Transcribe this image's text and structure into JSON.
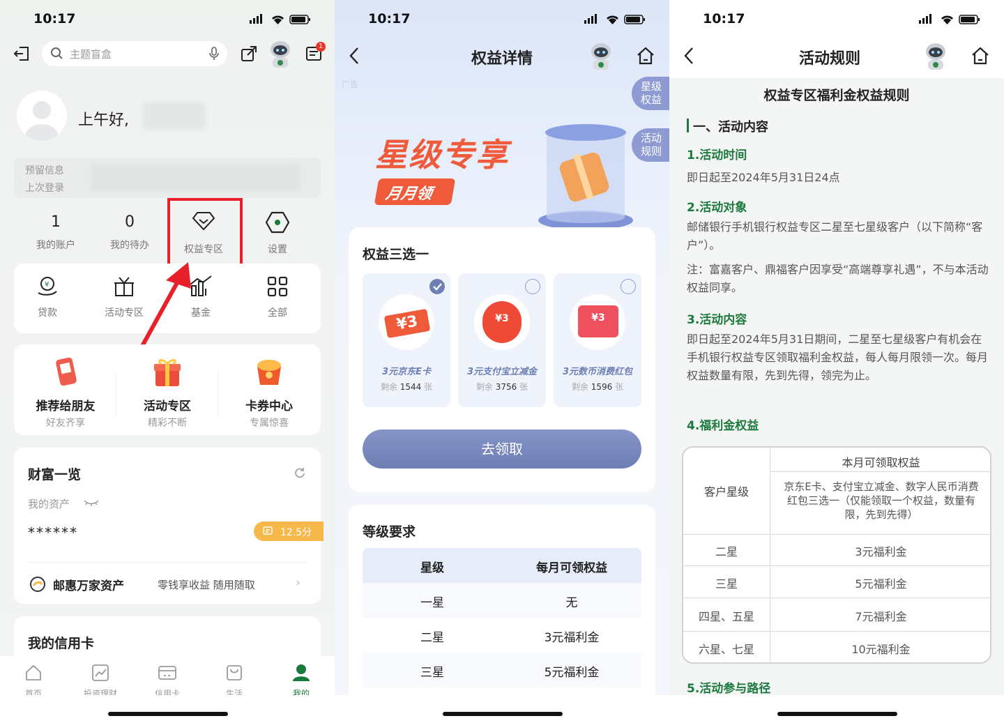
{
  "status_time": "10:17",
  "screen1": {
    "search_placeholder": "主题盲盒",
    "notification_count": "1",
    "greeting": "上午好,",
    "info_line1": "预留信息",
    "info_line2": "上次登录",
    "stats": [
      {
        "value": "1",
        "label": "我的账户"
      },
      {
        "value": "0",
        "label": "我的待办"
      }
    ],
    "quick_links": [
      {
        "label": "权益专区",
        "icon": "diamond-icon"
      },
      {
        "label": "设置",
        "icon": "settings-icon"
      }
    ],
    "services": [
      {
        "label": "贷款",
        "icon": "loan-icon"
      },
      {
        "label": "活动专区",
        "icon": "gift-icon"
      },
      {
        "label": "基金",
        "icon": "fund-chart-icon"
      },
      {
        "label": "全部",
        "icon": "grid-icon"
      }
    ],
    "promos": [
      {
        "title": "推荐给朋友",
        "subtitle": "好友齐享"
      },
      {
        "title": "活动专区",
        "subtitle": "精彩不断"
      },
      {
        "title": "卡券中心",
        "subtitle": "专属惊喜"
      }
    ],
    "wealth": {
      "title": "财富一览",
      "assets_label": "我的资产",
      "masked_value": "******",
      "score_badge": "12.5分",
      "product_name": "邮惠万家资产",
      "product_desc": "零钱享收益 随用随取"
    },
    "credit_title": "我的信用卡",
    "nav": [
      {
        "label": "首页"
      },
      {
        "label": "投资理财"
      },
      {
        "label": "信用卡"
      },
      {
        "label": "生活"
      },
      {
        "label": "我的"
      }
    ],
    "active_color": "#1a7a3a",
    "highlight_color": "#e8202a"
  },
  "screen2": {
    "title": "权益详情",
    "ad_label": "广告",
    "side_tab1": "星级权益",
    "side_tab2": "活动规则",
    "banner_title": "星级专享",
    "banner_sub": "月月领",
    "choose_title": "权益三选一",
    "options": [
      {
        "name": "3元京东E卡",
        "remain_prefix": "剩余",
        "count": "1544",
        "unit": "张",
        "badge": "¥3",
        "selected": true
      },
      {
        "name": "3元支付宝立减金",
        "remain_prefix": "剩余",
        "count": "3756",
        "unit": "张",
        "badge": "¥3",
        "selected": false
      },
      {
        "name": "3元数币消费红包",
        "remain_prefix": "剩余",
        "count": "1596",
        "unit": "张",
        "badge": "¥3",
        "selected": false
      }
    ],
    "claim_button": "去领取",
    "level_title": "等级要求",
    "table_headers": [
      "星级",
      "每月可领权益"
    ],
    "table_rows": [
      [
        "一星",
        "无"
      ],
      [
        "二星",
        "3元福利金"
      ],
      [
        "三星",
        "5元福利金"
      ]
    ],
    "accent_color": "#6e7fb3"
  },
  "screen3": {
    "title": "活动规则",
    "doc_title": "权益专区福利金权益规则",
    "section1": "一、活动内容",
    "h_time": "1.活动时间",
    "p_time": "即日起至2024年5月31日24点",
    "h_target": "2.活动对象",
    "p_target": "邮储银行手机银行权益专区二星至七星级客户（以下简称“客户”）。",
    "p_note": "注：富嘉客户、鼎福客户因享受“高端尊享礼遇”，不与本活动权益同享。",
    "h_content": "3.活动内容",
    "p_content": "即日起至2024年5月31日期间，二星至七星级客户有机会在手机银行权益专区领取福利金权益，每人每月限领一次。每月权益数量有限，先到先得，领完为止。",
    "h_benefit": "4.福利金权益",
    "table_header_right": "本月可领取权益",
    "table_header_left": "客户星级",
    "table_desc": "京东E卡、支付宝立减金、数字人民币消费红包三选一（仅能领取一个权益，数量有限，先到先得）",
    "table_rows": [
      [
        "二星",
        "3元福利金"
      ],
      [
        "三星",
        "5元福利金"
      ],
      [
        "四星、五星",
        "7元福利金"
      ],
      [
        "六星、七星",
        "10元福利金"
      ]
    ],
    "h_path": "5.活动参与路径",
    "heading_color": "#1c7a3e"
  }
}
